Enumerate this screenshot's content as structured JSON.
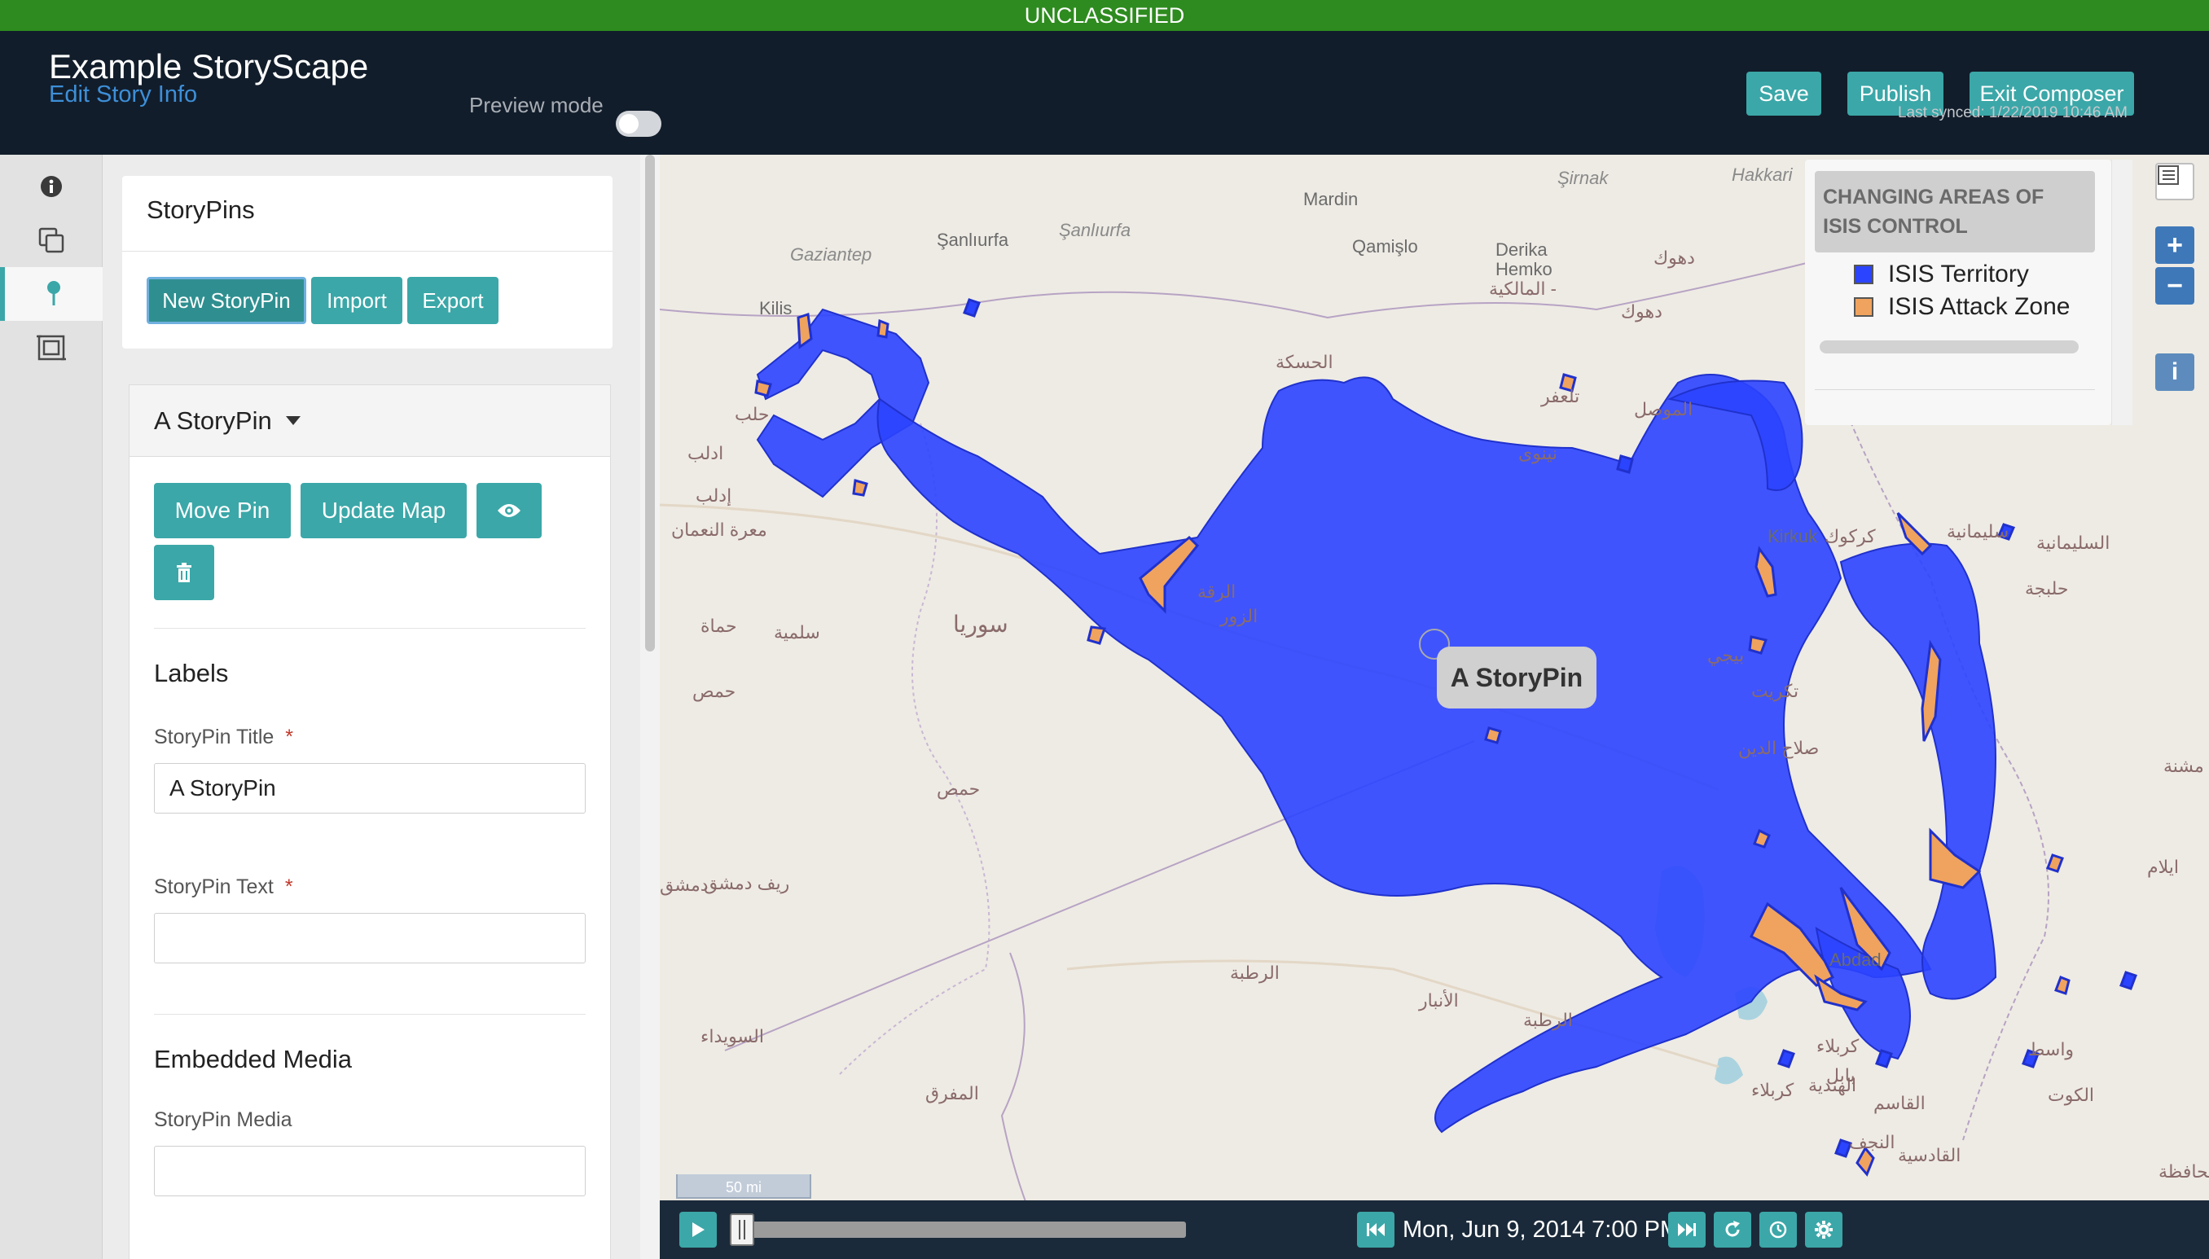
{
  "banner": {
    "text": "UNCLASSIFIED",
    "color": "#2e8b1f"
  },
  "header": {
    "title": "Example StoryScape",
    "edit_link": "Edit Story Info",
    "preview_label": "Preview mode",
    "preview_on": false,
    "save": "Save",
    "publish": "Publish",
    "exit": "Exit Composer",
    "last_synced": "Last synced: 1/22/2019 10:46 AM"
  },
  "rail": {
    "items": [
      {
        "icon": "info-icon",
        "active": false
      },
      {
        "icon": "copy-icon",
        "active": false
      },
      {
        "icon": "map-pin-icon",
        "active": true
      },
      {
        "icon": "frame-icon",
        "active": false
      }
    ]
  },
  "storypins": {
    "heading": "StoryPins",
    "new_pin": "New StoryPin",
    "import": "Import",
    "export": "Export"
  },
  "pin": {
    "title": "A StoryPin",
    "move_pin": "Move Pin",
    "update_map": "Update Map",
    "labels_heading": "Labels",
    "title_label": "StoryPin Title",
    "title_value": "A StoryPin",
    "text_label": "StoryPin Text",
    "text_value": "",
    "media_heading": "Embedded Media",
    "media_label": "StoryPin Media",
    "media_value": "",
    "required_mark": "*"
  },
  "map": {
    "pin_label": "A StoryPin",
    "scale": "50 mi",
    "labels": [
      "Şanlıurfa",
      "Şanlıurfa",
      "Gaziantep",
      "Kilis",
      "Mardin",
      "Qamişlo",
      "Derika",
      "Hemko",
      "المالكية -",
      "دهوك",
      "دهوك",
      "Şirnak",
      "Hakkari",
      "حلب",
      "ادلب",
      "إدلب",
      "معرة النعمان",
      "الحسكة",
      "نينوى",
      "الموصل",
      "تلعفر",
      "كركوك",
      "Kirkuk",
      "سليمانية",
      "السليمانية",
      "حلبجة",
      "الرقة",
      "الزور",
      "سوريا",
      "حماة",
      "سلمية",
      "حمص",
      "حمص",
      "تكريت",
      "صلاح الدين",
      "بيجي",
      "ريف دمشق",
      "دمشق",
      "مشنة",
      "ايلام",
      "الأنبار",
      "الرطبة",
      "الرطبة",
      "السويداء",
      "المفرق",
      "كربلاء",
      "كربلاء",
      "بابل",
      "الهندية",
      "واسط",
      "الكوت",
      "القاسم",
      "القادسية",
      "النجف",
      "Abdad",
      "محافظة"
    ]
  },
  "legend": {
    "title": "CHANGING AREAS OF ISIS CONTROL",
    "items": [
      {
        "label": "ISIS Territory",
        "color": "#2b44ff"
      },
      {
        "label": "ISIS Attack Zone",
        "color": "#f0a35e"
      }
    ]
  },
  "map_controls": {
    "zoom_in": "+",
    "zoom_out": "−",
    "info": "i"
  },
  "timeline": {
    "date": "Mon, Jun 9, 2014 7:00 PM",
    "progress": 0.0
  },
  "colors": {
    "accent": "#3ba7a8",
    "header": "#121d2b",
    "territory": "#2b44ff",
    "attack": "#f0a35e"
  }
}
